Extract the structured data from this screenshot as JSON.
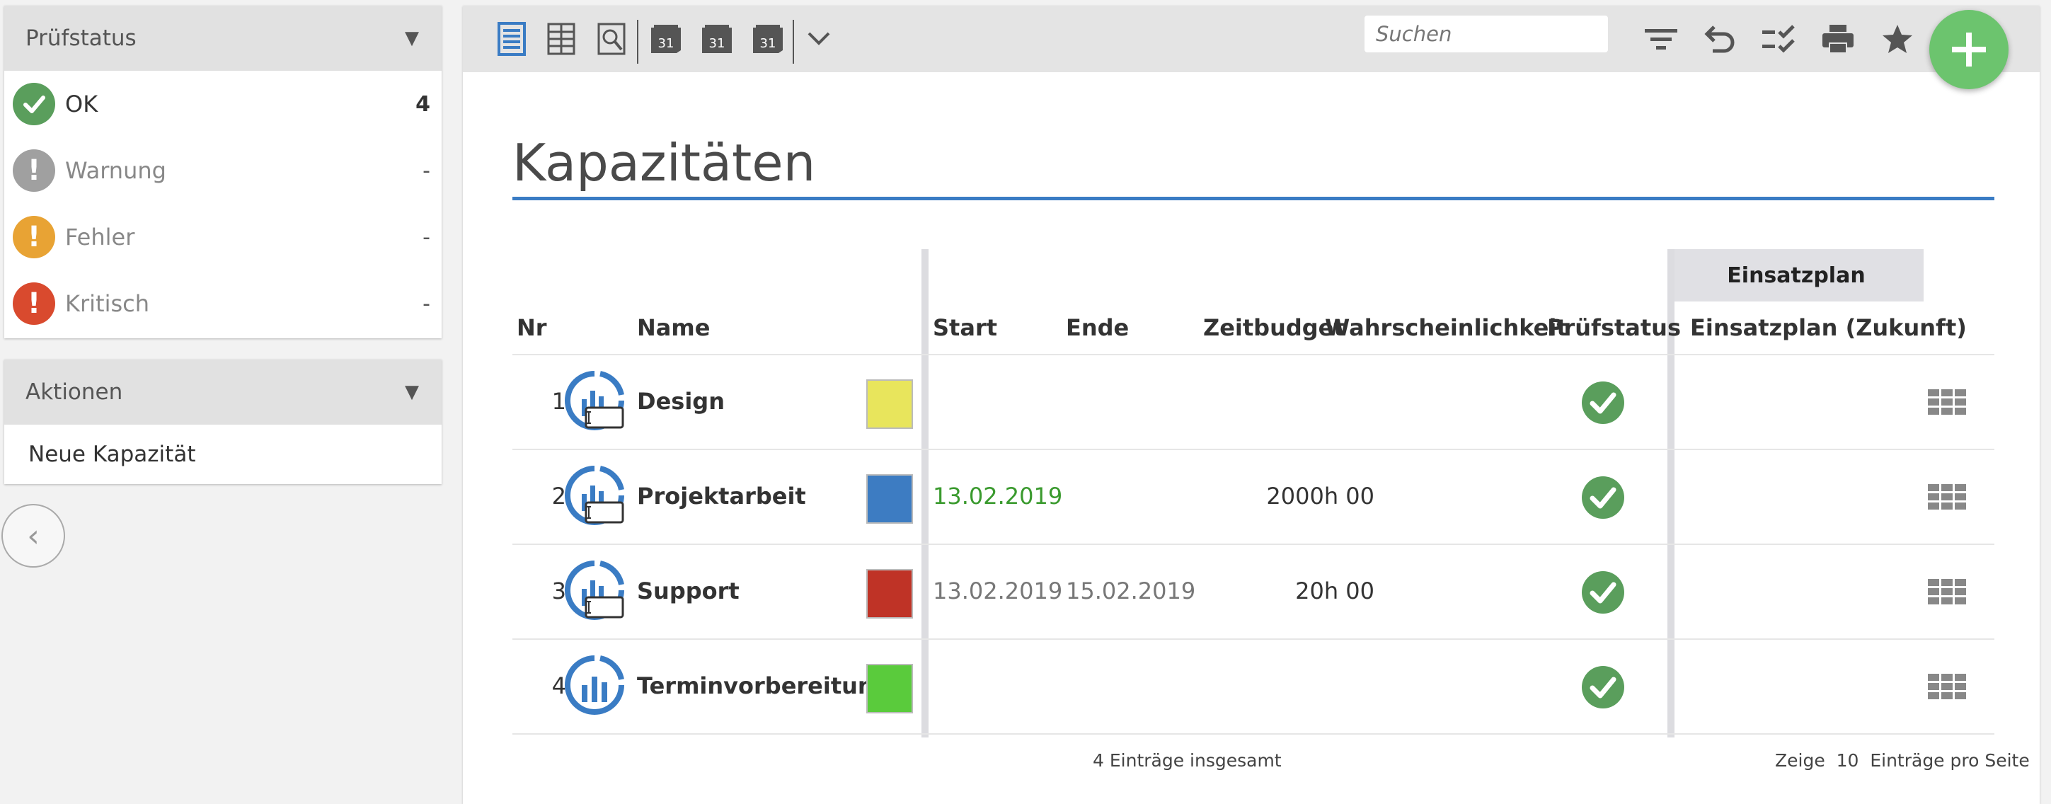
{
  "sidebar": {
    "status_panel": {
      "title": "Prüfstatus",
      "items": [
        {
          "label": "OK",
          "count": "4",
          "color": "#5a9e5c",
          "icon": "check-icon"
        },
        {
          "label": "Warnung",
          "count": "-",
          "color": "#a0a0a0",
          "icon": "exclamation-icon"
        },
        {
          "label": "Fehler",
          "count": "-",
          "color": "#e8a334",
          "icon": "exclamation-icon"
        },
        {
          "label": "Kritisch",
          "count": "-",
          "color": "#d94a2e",
          "icon": "exclamation-icon"
        }
      ]
    },
    "actions_panel": {
      "title": "Aktionen",
      "items": [
        {
          "label": "Neue Kapazität"
        }
      ]
    },
    "collapse_glyph": "‹"
  },
  "toolbar": {
    "calendar_day": "31",
    "search_placeholder": "Suchen",
    "accent": "#3a7cc4"
  },
  "page": {
    "title": "Kapazitäten"
  },
  "table": {
    "group_header": "Einsatzplan",
    "columns": {
      "nr": "Nr",
      "name": "Name",
      "start": "Start",
      "end": "Ende",
      "budget": "Zeitbudget",
      "probability": "Wahrscheinlichkeit",
      "status": "Prüfstatus",
      "plan": "Einsatzplan (Zukunft)"
    },
    "rows": [
      {
        "nr": "1",
        "name": "Design",
        "color": "#e8e55c",
        "start": "",
        "end": "",
        "budget": "",
        "status": "ok"
      },
      {
        "nr": "2",
        "name": "Projektarbeit",
        "color": "#3d7cc2",
        "start": "13.02.2019",
        "start_color": "#3a9a2e",
        "end": "",
        "budget": "2000h 00",
        "status": "ok"
      },
      {
        "nr": "3",
        "name": "Support",
        "color": "#bf3326",
        "start": "13.02.2019",
        "start_color": "#777777",
        "end": "15.02.2019",
        "budget": "20h 00",
        "status": "ok"
      },
      {
        "nr": "4",
        "name": "Terminvorbereitung",
        "color": "#5acb3c",
        "start": "",
        "end": "",
        "budget": "",
        "status": "ok"
      }
    ],
    "footer": {
      "total": "4 Einträge insgesamt",
      "page_prefix": "Zeige",
      "page_size": "10",
      "page_suffix": "Einträge pro Seite"
    }
  }
}
